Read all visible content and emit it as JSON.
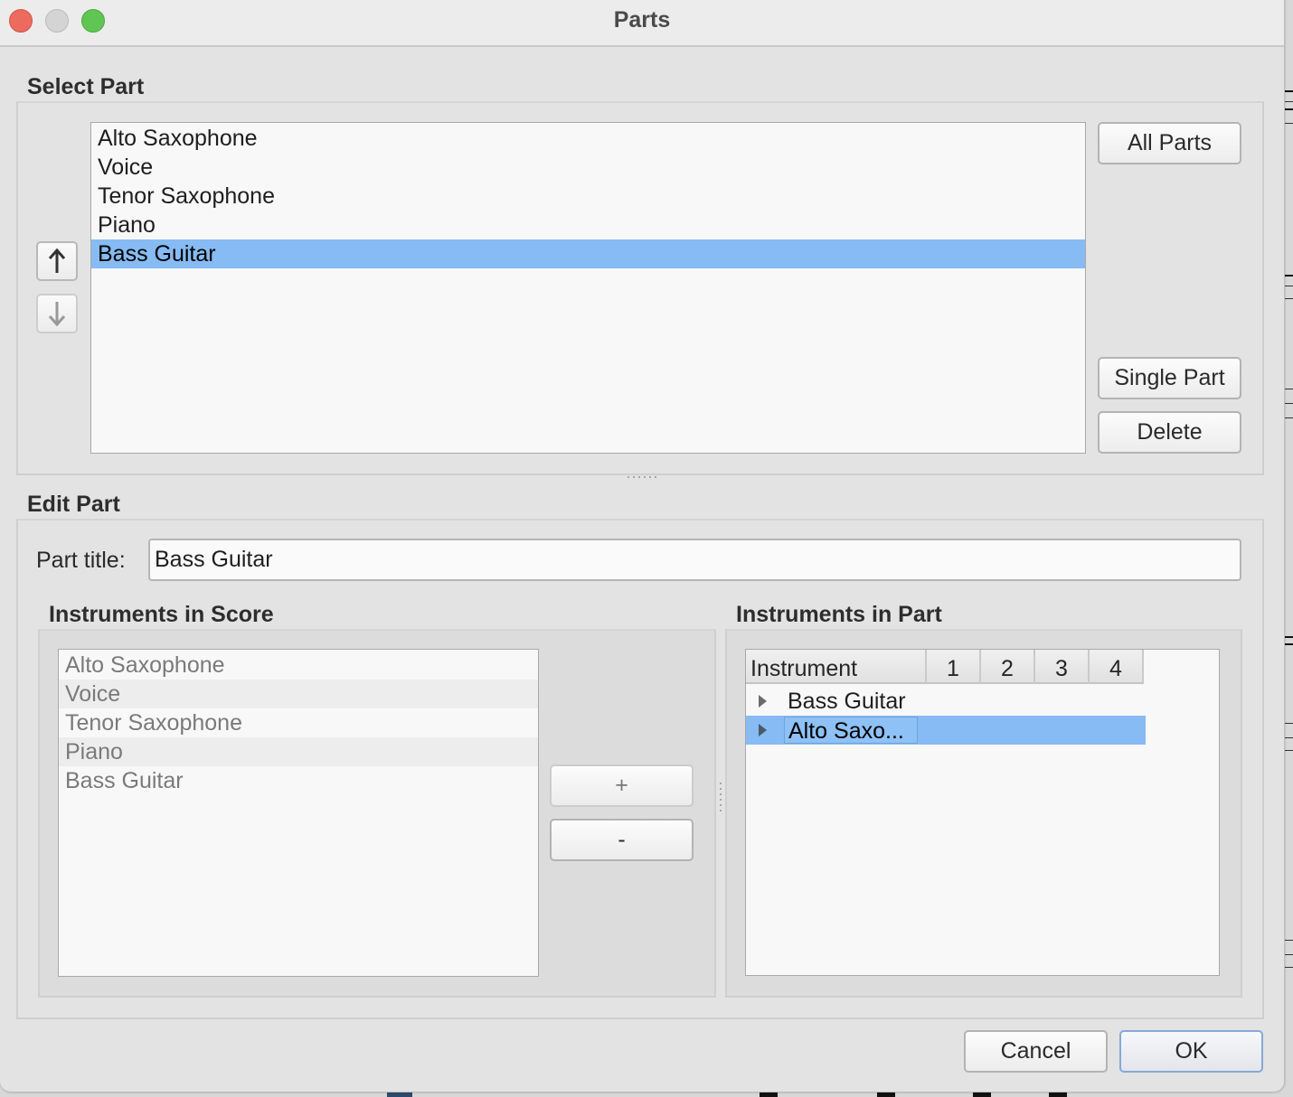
{
  "window": {
    "title": "Parts",
    "traffic_lights": {
      "close_color": "#ec6a5e",
      "minimize_color": "#d4d4d4",
      "maximize_color": "#61c554"
    }
  },
  "select_part": {
    "group_label": "Select Part",
    "parts": [
      {
        "label": "Alto Saxophone",
        "selected": false
      },
      {
        "label": "Voice",
        "selected": false
      },
      {
        "label": "Tenor Saxophone",
        "selected": false
      },
      {
        "label": "Piano",
        "selected": false
      },
      {
        "label": "Bass Guitar",
        "selected": true
      }
    ],
    "move_up_icon": "arrow-up-icon",
    "move_down_icon": "arrow-down-icon",
    "all_parts_label": "All Parts",
    "single_part_label": "Single Part",
    "delete_label": "Delete",
    "selection_color": "#86bbf3"
  },
  "edit_part": {
    "group_label": "Edit Part",
    "part_title_label": "Part title:",
    "part_title_value": "Bass Guitar",
    "instruments_in_score": {
      "group_label": "Instruments in Score",
      "items": [
        "Alto Saxophone",
        "Voice",
        "Tenor Saxophone",
        "Piano",
        "Bass Guitar"
      ]
    },
    "add_label": "+",
    "remove_label": "-",
    "instruments_in_part": {
      "group_label": "Instruments in Part",
      "columns": [
        "Instrument",
        "1",
        "2",
        "3",
        "4"
      ],
      "rows": [
        {
          "label": "Bass Guitar",
          "selected": false,
          "expand_icon": "disclosure-triangle-icon"
        },
        {
          "label": "Alto Saxo...",
          "selected": true,
          "expand_icon": "disclosure-triangle-icon"
        }
      ]
    }
  },
  "footer": {
    "cancel_label": "Cancel",
    "ok_label": "OK"
  }
}
